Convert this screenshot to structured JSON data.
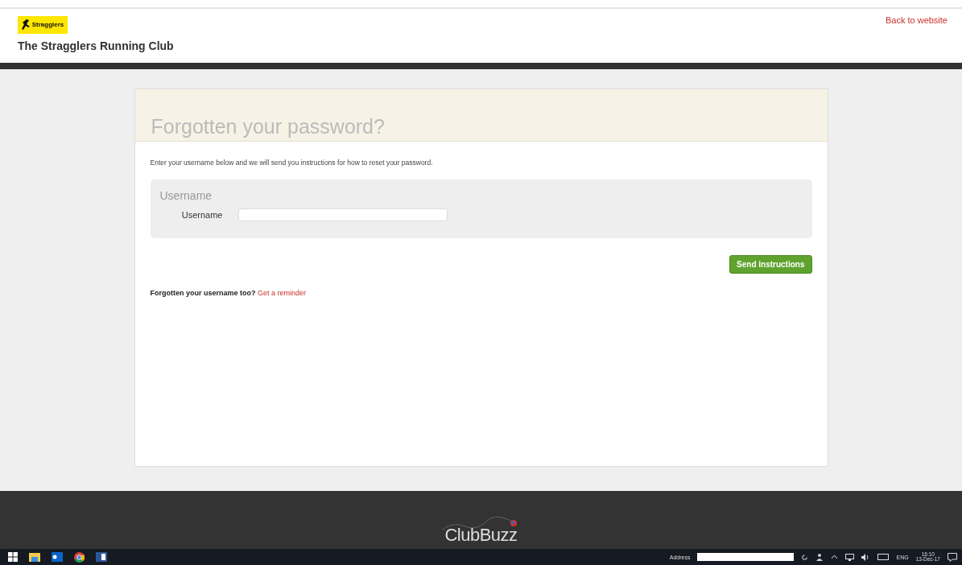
{
  "header": {
    "logo_text": "Stragglers",
    "club_name": "The Stragglers Running Club",
    "back_link": "Back to website"
  },
  "card": {
    "title": "Forgotten your password?",
    "intro": "Enter your username below and we will send you instructions for how to reset your password.",
    "fieldset": {
      "legend": "Username",
      "label": "Username"
    },
    "submit": "Send instructions",
    "reminder": {
      "text": "Forgotten your username too?",
      "link": "Get a reminder"
    }
  },
  "footer": {
    "logo": "ClubBuzz"
  },
  "taskbar": {
    "address_label": "Address",
    "language": "ENG",
    "time": "16:10",
    "date": "13-Dec-17"
  }
}
